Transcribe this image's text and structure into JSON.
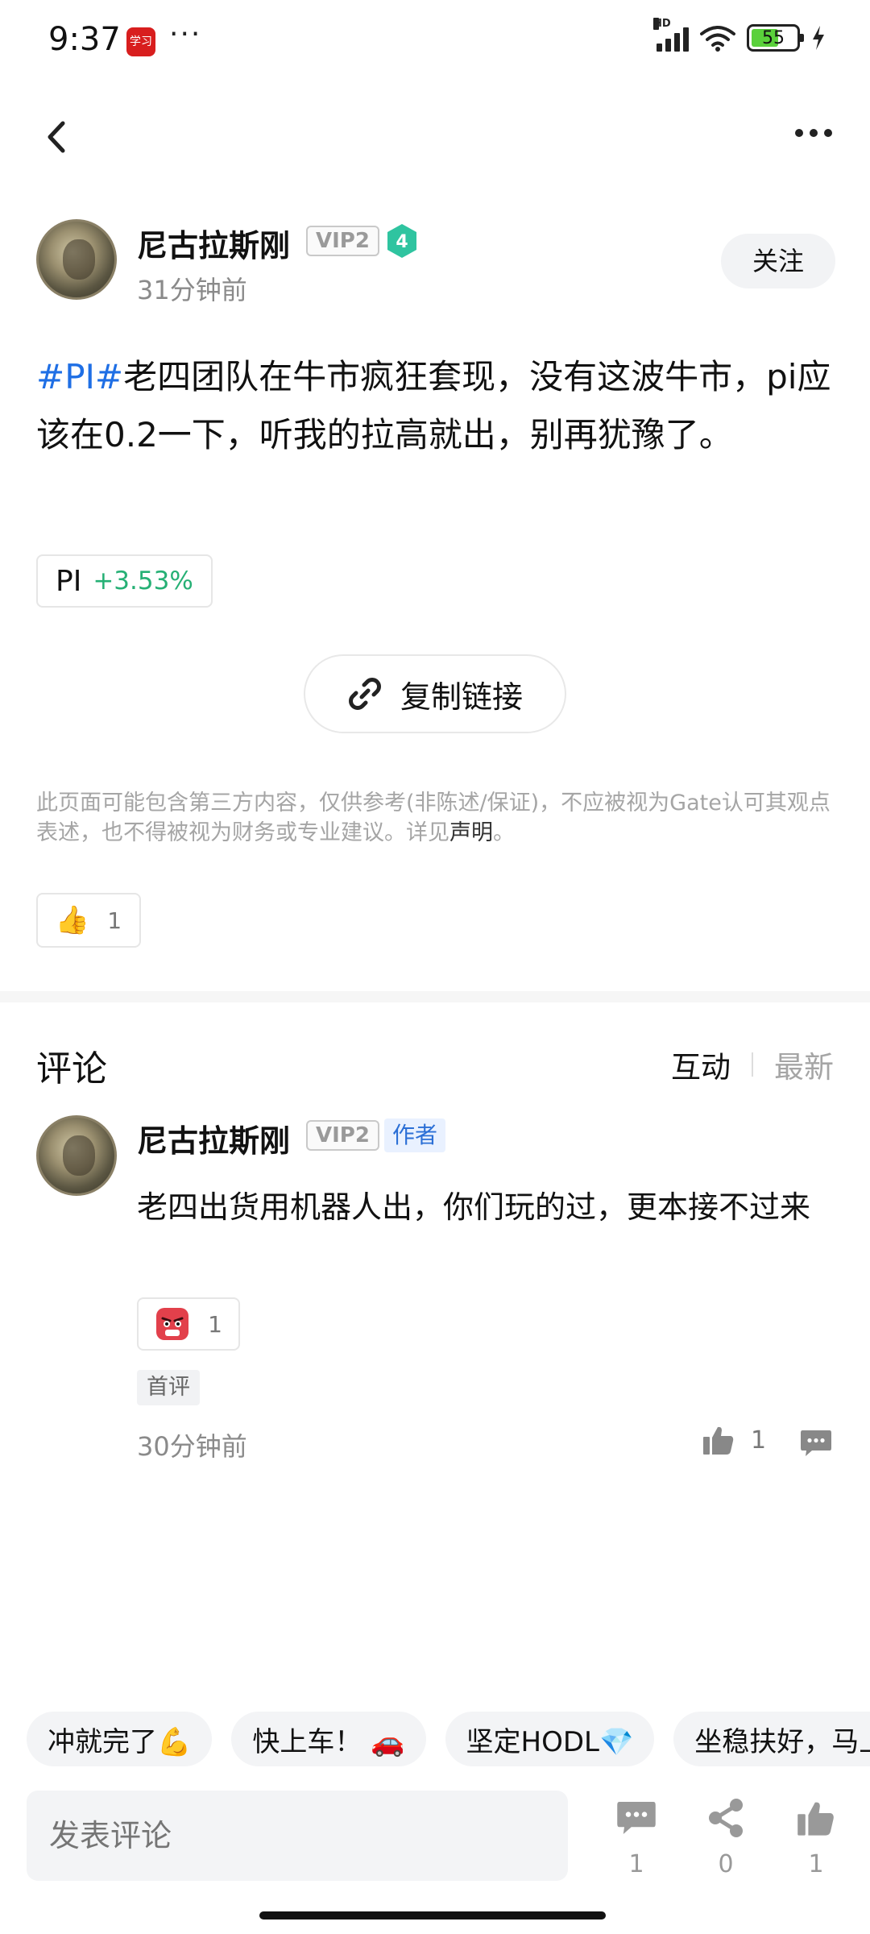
{
  "status_bar": {
    "time": "9:37",
    "app_badge": "学习",
    "dots": "···",
    "battery": "55",
    "network": "HD"
  },
  "post": {
    "author": {
      "name": "尼古拉斯刚",
      "vip": "VIP2",
      "level": "4"
    },
    "time": "31分钟前",
    "follow_label": "关注",
    "hashtag": "#PI#",
    "body": "老四团队在牛市疯狂套现，没有这波牛市，pi应该在0.2一下，听我的拉高就出，别再犹豫了。",
    "ticker": {
      "symbol": "PI",
      "change": "+3.53%"
    },
    "copy_link_label": "复制链接",
    "disclaimer": "此页面可能包含第三方内容，仅供参考(非陈述/保证)，不应被视为Gate认可其观点表述，也不得被视为财务或专业建议。详见",
    "disclaimer_link": "声明",
    "disclaimer_end": "。",
    "reaction": {
      "emoji": "👍",
      "count": "1"
    }
  },
  "comments": {
    "title": "评论",
    "sort": {
      "active": "互动",
      "inactive": "最新"
    },
    "items": [
      {
        "author": "尼古拉斯刚",
        "vip": "VIP2",
        "author_tag": "作者",
        "text": "老四出货用机器人出，你们玩的过，更本接不过来",
        "reaction_count": "1",
        "first_tag": "首评",
        "time": "30分钟前",
        "likes": "1"
      }
    ]
  },
  "quick_replies": [
    "冲就完了💪",
    "快上车！ 🚗",
    "坚定HODL💎",
    "坐稳扶好，马上起飞"
  ],
  "bottom_bar": {
    "input_placeholder": "发表评论",
    "comments_count": "1",
    "shares_count": "0",
    "likes_count": "1"
  },
  "colors": {
    "hashtag": "#1f6fe5",
    "positive": "#26b075",
    "author_tag": "#2b6fd6",
    "level_badge": "#2fc4a0"
  }
}
